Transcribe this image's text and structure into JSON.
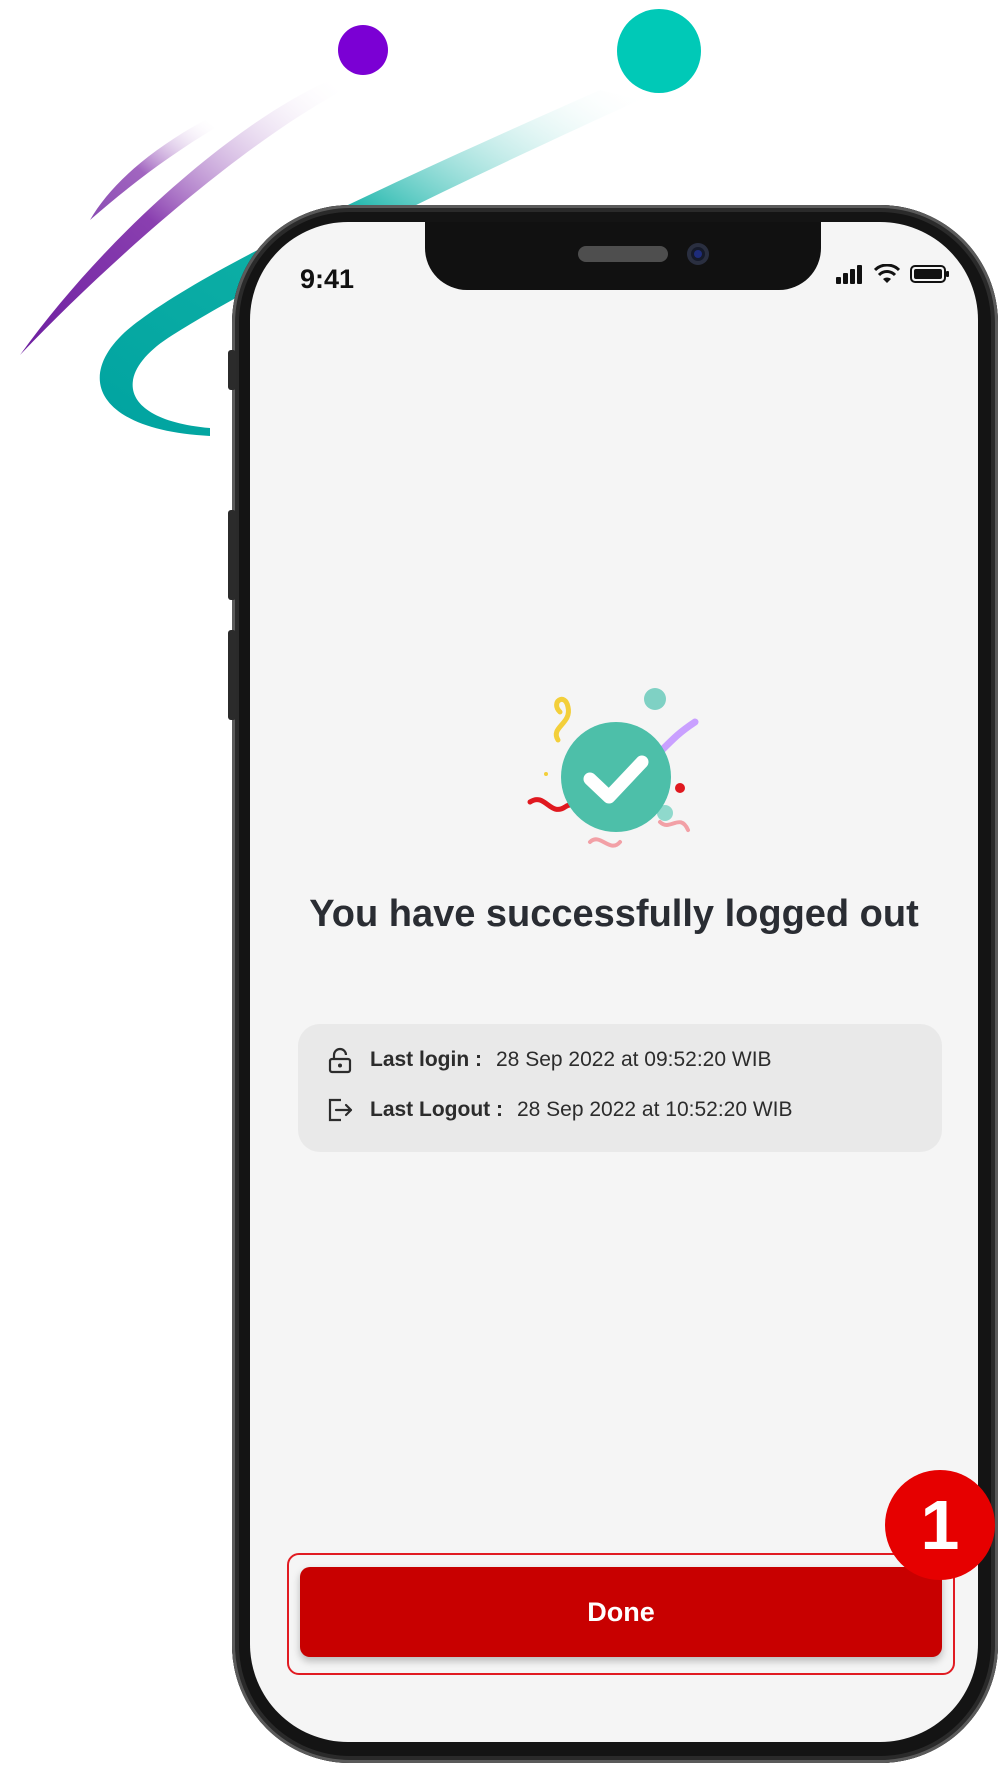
{
  "status_bar": {
    "time": "9:41"
  },
  "success": {
    "title": "You have successfully logged out"
  },
  "session_info": {
    "last_login_label": "Last login :",
    "last_login_value": "28 Sep 2022 at 09:52:20 WIB",
    "last_logout_label": "Last Logout :",
    "last_logout_value": "28 Sep 2022 at 10:52:20 WIB"
  },
  "actions": {
    "done_label": "Done"
  },
  "annotation": {
    "step_number": "1"
  },
  "icons": [
    "signal-icon",
    "wifi-icon",
    "battery-icon",
    "check-icon",
    "lock-icon",
    "logout-icon"
  ],
  "colors": {
    "primary": "#c80000",
    "accent_teal": "#4dbfa9",
    "decor_teal": "#00c9b7",
    "decor_purple": "#7b00d4"
  }
}
